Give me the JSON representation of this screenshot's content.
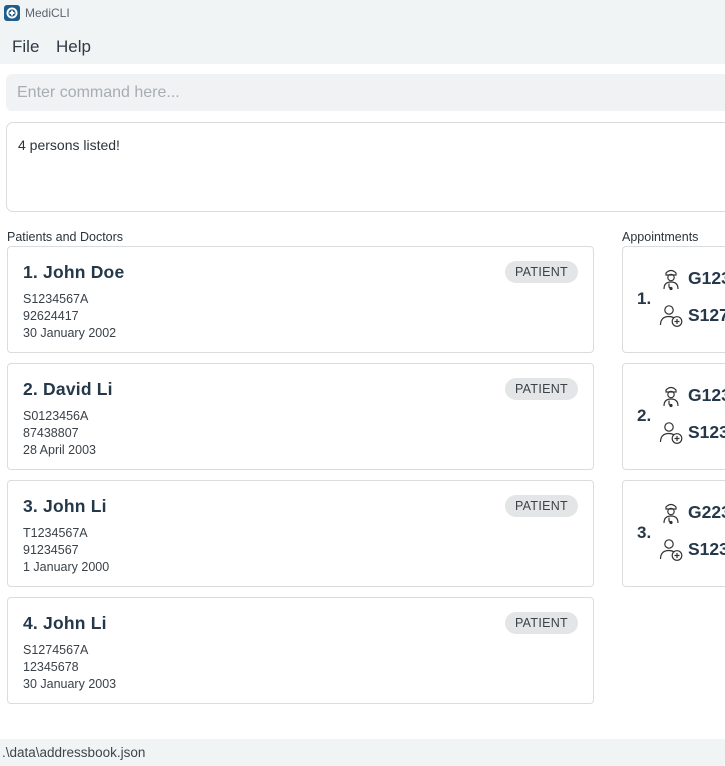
{
  "window": {
    "title": "MediCLI"
  },
  "menu": {
    "file": "File",
    "help": "Help"
  },
  "command": {
    "placeholder": "Enter command here...",
    "value": ""
  },
  "result": {
    "message": "4 persons listed!"
  },
  "persons_panel": {
    "title": "Patients and Doctors",
    "persons": [
      {
        "index_name": "1.  John Doe",
        "type": "PATIENT",
        "nric": "S1234567A",
        "phone": "92624417",
        "dob": "30 January 2002"
      },
      {
        "index_name": "2.  David Li",
        "type": "PATIENT",
        "nric": "S0123456A",
        "phone": "87438807",
        "dob": "28 April 2003"
      },
      {
        "index_name": "3.  John Li",
        "type": "PATIENT",
        "nric": "T1234567A",
        "phone": "91234567",
        "dob": "1 January 2000"
      },
      {
        "index_name": "4.  John Li",
        "type": "PATIENT",
        "nric": "S1274567A",
        "phone": "12345678",
        "dob": "30 January 2003"
      }
    ]
  },
  "appointments_panel": {
    "title": "Appointments",
    "appointments": [
      {
        "index": "1.",
        "doctor_id": "G123",
        "patient_id": "S127"
      },
      {
        "index": "2.",
        "doctor_id": "G123",
        "patient_id": "S123"
      },
      {
        "index": "3.",
        "doctor_id": "G223",
        "patient_id": "S123"
      }
    ]
  },
  "status_bar": {
    "path": ".\\data\\addressbook.json"
  },
  "icons": {
    "app": "medicli-app-icon",
    "doctor": "doctor-icon",
    "patient": "patient-icon"
  },
  "colors": {
    "chrome_bg": "#f1f4f4",
    "name_text": "#25384a",
    "badge_bg": "#e3e5e6"
  }
}
